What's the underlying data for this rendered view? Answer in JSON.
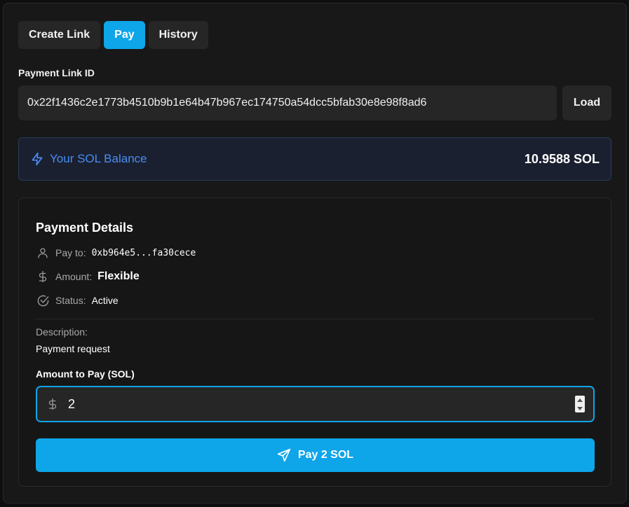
{
  "tabs": [
    {
      "label": "Create Link",
      "active": false
    },
    {
      "label": "Pay",
      "active": true
    },
    {
      "label": "History",
      "active": false
    }
  ],
  "link": {
    "label": "Payment Link ID",
    "value": "0x22f1436c2e1773b4510b9b1e64b47b967ec174750a54dcc5bfab30e8e98f8ad6",
    "load_label": "Load"
  },
  "balance": {
    "label": "Your SOL Balance",
    "value": "10.9588 SOL",
    "icon": "lightning-icon"
  },
  "details": {
    "title": "Payment Details",
    "pay_to_label": "Pay to:",
    "pay_to_value": "0xb964e5...fa30cece",
    "amount_label": "Amount:",
    "amount_value": "Flexible",
    "status_label": "Status:",
    "status_value": "Active",
    "description_label": "Description:",
    "description_value": "Payment request"
  },
  "amount_input": {
    "label": "Amount to Pay (SOL)",
    "value": "2"
  },
  "pay_button": {
    "label": "Pay 2 SOL",
    "icon": "send-icon"
  },
  "colors": {
    "accent": "#0ea5e9",
    "balance_text": "#4a8cf2",
    "panel": "#181818"
  }
}
